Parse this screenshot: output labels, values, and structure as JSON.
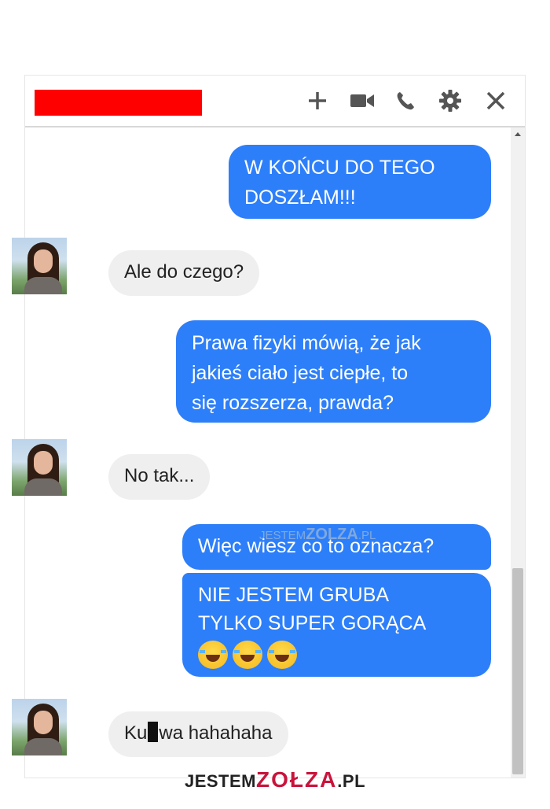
{
  "header": {
    "icons": [
      "add-icon",
      "video-call-icon",
      "phone-call-icon",
      "settings-gear-icon",
      "close-icon"
    ]
  },
  "messages": [
    {
      "from": "me",
      "lines": [
        "W KOŃCU DO TEGO",
        "DOSZŁAM!!!"
      ]
    },
    {
      "from": "other",
      "text": "Ale do czego?"
    },
    {
      "from": "me",
      "lines": [
        "Prawa fizyki mówią, że jak",
        "jakieś ciało jest ciepłe, to",
        "się rozszerza, prawda?"
      ]
    },
    {
      "from": "other",
      "text": "No tak..."
    },
    {
      "from": "me",
      "lines": [
        "Więc wiesz co to oznacza?"
      ]
    },
    {
      "from": "me",
      "lines": [
        "NIE JESTEM GRUBA",
        "TYLKO SUPER GORĄCA"
      ],
      "emoji": [
        "laughing-tears-emoji",
        "laughing-tears-emoji",
        "laughing-tears-emoji"
      ]
    },
    {
      "from": "other",
      "text_before_censor": "Ku",
      "text_after_censor": "wa hahahaha"
    }
  ],
  "watermarks": {
    "middle_prefix": "JESTEM",
    "middle_brand": "ZOLZA",
    "middle_suffix": ".PL",
    "footer_prefix": "JESTEM",
    "footer_brand": "ZOŁZA",
    "footer_suffix": ".PL"
  },
  "colors": {
    "outgoing_bubble": "#2d7ff9",
    "incoming_bubble": "#efefef",
    "name_redaction": "#ff0000",
    "brand_accent": "#c8143c"
  }
}
